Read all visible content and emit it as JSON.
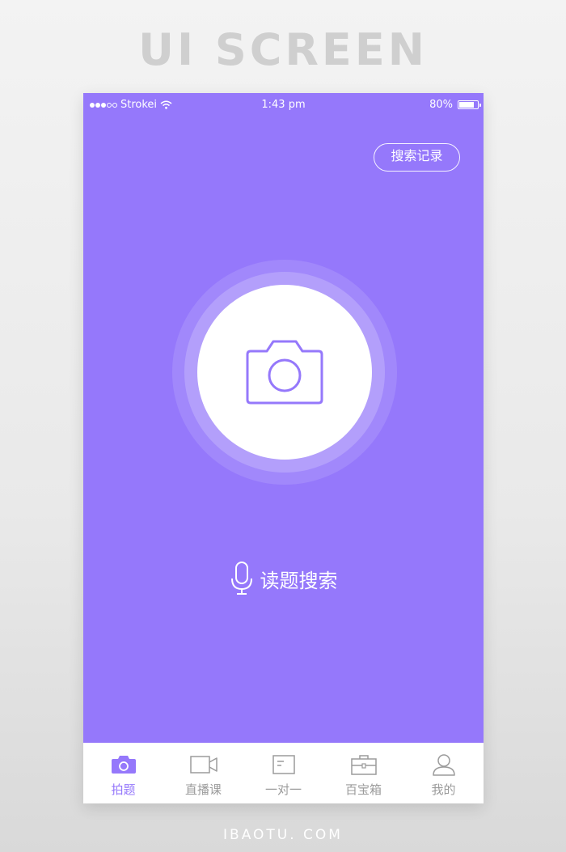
{
  "banner": {
    "title": "UI SCREEN",
    "credit": "IBAOTU. COM"
  },
  "colors": {
    "primary": "#9578fb",
    "white": "#ffffff",
    "tab_inactive": "#9b9b9b"
  },
  "status_bar": {
    "carrier": "Strokei",
    "time": "1:43 pm",
    "battery": "80%",
    "battery_level": 0.8
  },
  "header": {
    "history_label": "搜索记录"
  },
  "main": {
    "camera_icon": "camera-icon",
    "voice_label": "读题搜索",
    "voice_icon": "microphone-icon"
  },
  "tabs": [
    {
      "label": "拍题",
      "icon": "camera-icon",
      "active": true
    },
    {
      "label": "直播课",
      "icon": "video-camera-icon",
      "active": false
    },
    {
      "label": "一对一",
      "icon": "message-icon",
      "active": false
    },
    {
      "label": "百宝箱",
      "icon": "briefcase-icon",
      "active": false
    },
    {
      "label": "我的",
      "icon": "user-icon",
      "active": false
    }
  ]
}
